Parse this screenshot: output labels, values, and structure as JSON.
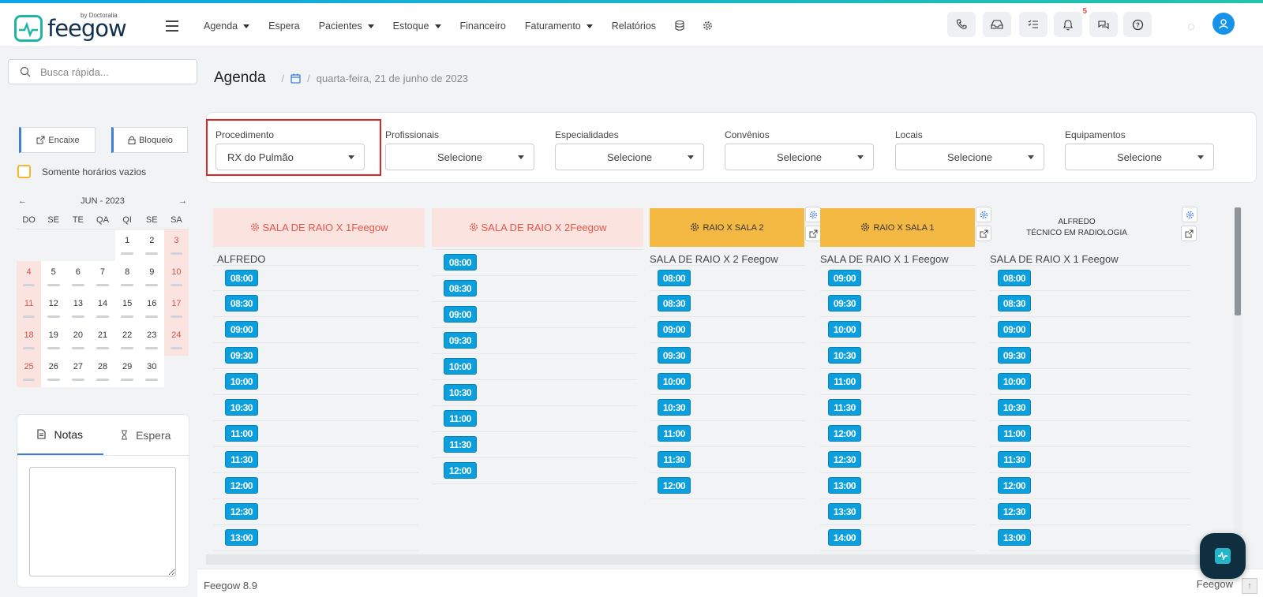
{
  "brand": {
    "name": "feegow",
    "by": "by Doctoralia"
  },
  "nav": [
    {
      "label": "Agenda",
      "dropdown": true
    },
    {
      "label": "Espera",
      "dropdown": false
    },
    {
      "label": "Pacientes",
      "dropdown": true
    },
    {
      "label": "Estoque",
      "dropdown": true
    },
    {
      "label": "Financeiro",
      "dropdown": false
    },
    {
      "label": "Faturamento",
      "dropdown": true
    },
    {
      "label": "Relatórios",
      "dropdown": false
    }
  ],
  "notifications": {
    "count": "5"
  },
  "search": {
    "placeholder": "Busca rápida..."
  },
  "sidebar": {
    "encaixe": "Encaixe",
    "bloqueio": "Bloqueio",
    "only_empty": "Somente horários vazios"
  },
  "calendar": {
    "title": "JUN - 2023",
    "weekdays": [
      "DO",
      "SE",
      "TE",
      "QA",
      "QI",
      "SE",
      "SA"
    ],
    "weeks": [
      [
        "",
        "",
        "",
        "",
        "1",
        "2",
        "3"
      ],
      [
        "4",
        "5",
        "6",
        "7",
        "8",
        "9",
        "10"
      ],
      [
        "11",
        "12",
        "13",
        "14",
        "15",
        "16",
        "17"
      ],
      [
        "18",
        "19",
        "20",
        "21",
        "22",
        "23",
        "24"
      ],
      [
        "25",
        "26",
        "27",
        "28",
        "29",
        "30",
        ""
      ]
    ]
  },
  "notes": {
    "tab_notes": "Notas",
    "tab_wait": "Espera"
  },
  "breadcrumb": {
    "title": "Agenda",
    "date": "quarta-feira, 21 de junho de 2023"
  },
  "filters": [
    {
      "label": "Procedimento",
      "value": "RX do Pulmão"
    },
    {
      "label": "Profissionais",
      "value": "Selecione"
    },
    {
      "label": "Especialidades",
      "value": "Selecione"
    },
    {
      "label": "Convênios",
      "value": "Selecione"
    },
    {
      "label": "Locais",
      "value": "Selecione"
    },
    {
      "label": "Equipamentos",
      "value": "Selecione"
    }
  ],
  "columns": [
    {
      "title": "SALA DE RAIO X 1Feegow",
      "style": "pink",
      "subtitle": "ALFREDO",
      "times": [
        "08:00",
        "08:30",
        "09:00",
        "09:30",
        "10:00",
        "10:30",
        "11:00",
        "11:30",
        "12:00",
        "12:30",
        "13:00"
      ]
    },
    {
      "title": "SALA DE RAIO X 2Feegow",
      "style": "pink",
      "subtitle": "",
      "times": [
        "08:00",
        "08:30",
        "09:00",
        "09:30",
        "10:00",
        "10:30",
        "11:00",
        "11:30",
        "12:00"
      ]
    },
    {
      "title": "RAIO X SALA 2",
      "style": "orange",
      "subtitle": "SALA DE RAIO X 2 Feegow",
      "times": [
        "08:00",
        "08:30",
        "09:00",
        "09:30",
        "10:00",
        "10:30",
        "11:00",
        "11:30",
        "12:00"
      ]
    },
    {
      "title": "RAIO X SALA 1",
      "style": "orange",
      "subtitle": "SALA DE RAIO X 1 Feegow",
      "times": [
        "09:00",
        "09:30",
        "10:00",
        "10:30",
        "11:00",
        "11:30",
        "12:00",
        "12:30",
        "13:00",
        "13:30",
        "14:00"
      ]
    },
    {
      "title": "ALFREDO",
      "title2": "TÉCNICO EM RADIOLOGIA",
      "style": "plain",
      "subtitle": "SALA DE RAIO X 1 Feegow",
      "times": [
        "08:00",
        "08:30",
        "09:00",
        "09:30",
        "10:00",
        "10:30",
        "11:00",
        "11:30",
        "12:00",
        "12:30",
        "13:00"
      ]
    }
  ],
  "footer": {
    "version": "Feegow 8.9",
    "brand": "Feegow"
  }
}
